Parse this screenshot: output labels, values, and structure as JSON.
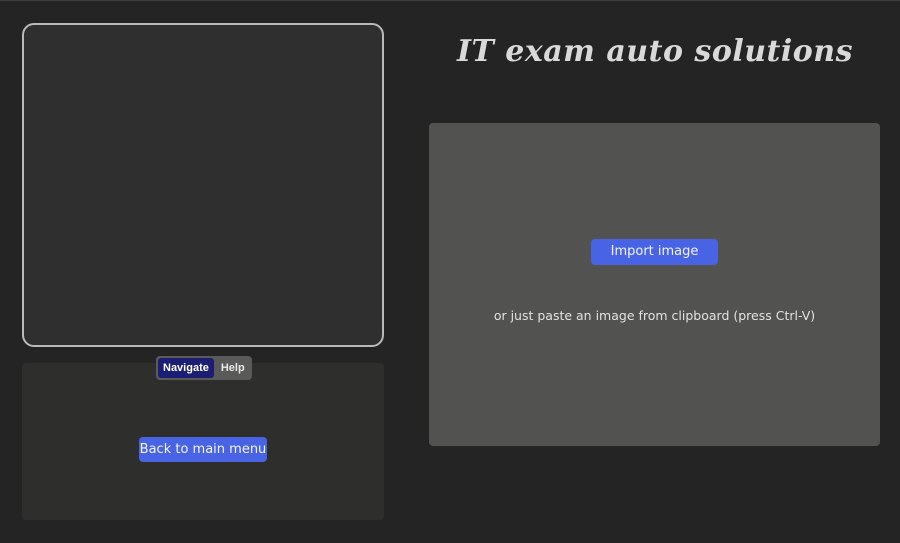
{
  "app": {
    "title": "IT exam auto solutions"
  },
  "left_panel": {
    "tabs": [
      {
        "label": "Navigate",
        "active": true
      },
      {
        "label": "Help",
        "active": false
      }
    ],
    "back_button_label": "Back to main menu"
  },
  "drop_zone": {
    "import_button_label": "Import image",
    "hint": "or just paste an image from clipboard (press Ctrl-V)"
  },
  "colors": {
    "background": "#242424",
    "accent_button": "#4863e3",
    "active_tab": "#1c1e74",
    "drop_zone": "#525351"
  }
}
